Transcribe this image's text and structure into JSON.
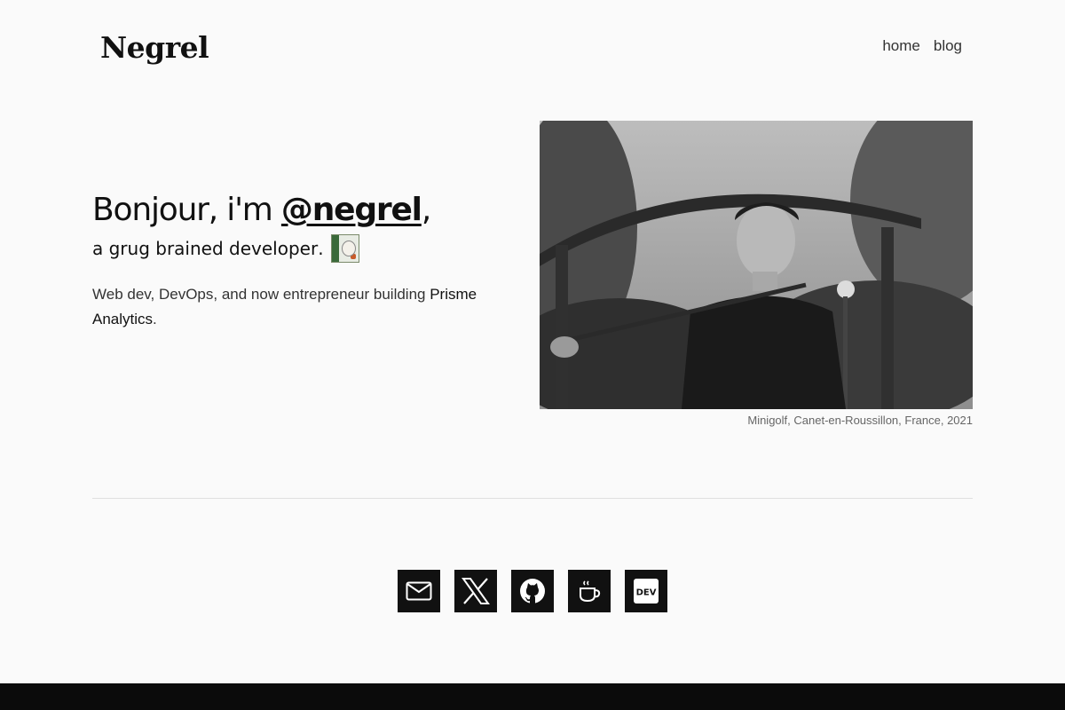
{
  "header": {
    "logo": "Negrel",
    "nav": [
      {
        "label": "home"
      },
      {
        "label": "blog"
      }
    ]
  },
  "hero": {
    "greeting": "Bonjour, i'm ",
    "handle": "@negrel",
    "handle_suffix": ",",
    "tagline_link": "a grug brained developer",
    "tagline_suffix": ".",
    "bio_prefix": "Web dev, DevOps, and now entrepreneur building ",
    "bio_link": "Prisme Analytics",
    "bio_suffix": "."
  },
  "photo": {
    "caption": "Minigolf, Canet-en-Roussillon, France, 2021"
  },
  "socials": [
    {
      "icon": "mail-icon"
    },
    {
      "icon": "x-icon"
    },
    {
      "icon": "github-icon"
    },
    {
      "icon": "coffee-icon"
    },
    {
      "icon": "dev-icon",
      "text": "DEV"
    }
  ],
  "colors": {
    "background": "#fafafa",
    "text": "#111111",
    "social_tile": "#111111",
    "footer": "#0b0b0b"
  }
}
